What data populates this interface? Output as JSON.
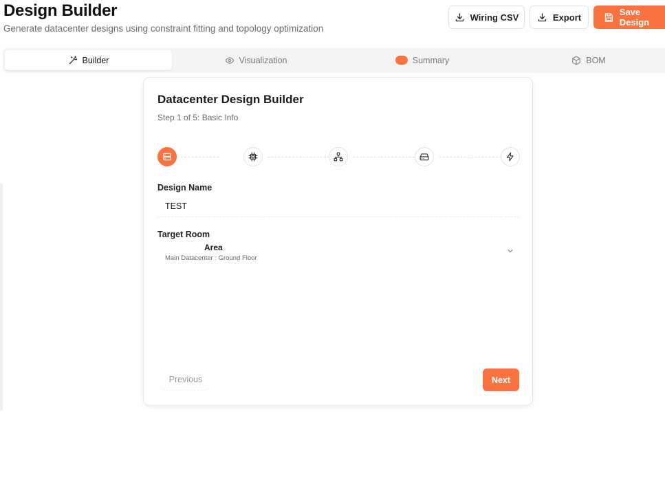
{
  "header": {
    "title": "Design Builder",
    "subtitle": "Generate datacenter designs using constraint fitting and topology optimization",
    "actions": {
      "wiring_csv": "Wiring CSV",
      "export": "Export",
      "save": "Save Design"
    }
  },
  "tabs": [
    {
      "label": "Builder",
      "icon": "wand-icon",
      "active": true
    },
    {
      "label": "Visualization",
      "icon": "eye-icon",
      "active": false
    },
    {
      "label": "Summary",
      "icon": "summary-icon",
      "active": false
    },
    {
      "label": "BOM",
      "icon": "cube-icon",
      "active": false
    }
  ],
  "card": {
    "title": "Datacenter Design Builder",
    "step_text": "Step 1 of 5: Basic Info",
    "steps": [
      {
        "icon": "server-icon",
        "active": true
      },
      {
        "icon": "cpu-icon",
        "active": false
      },
      {
        "icon": "network-icon",
        "active": false
      },
      {
        "icon": "drive-icon",
        "active": false
      },
      {
        "icon": "bolt-icon",
        "active": false
      }
    ],
    "design_name": {
      "label": "Design Name",
      "value": "TEST"
    },
    "target_room": {
      "label": "Target Room",
      "selected_title": "Area",
      "selected_subtitle": "Main Datacenter : Ground Floor"
    },
    "buttons": {
      "previous": "Previous",
      "next": "Next"
    }
  },
  "colors": {
    "accent": "#f97340",
    "muted_text": "#6b6b6b",
    "tab_bar": "#f4f4f5"
  }
}
